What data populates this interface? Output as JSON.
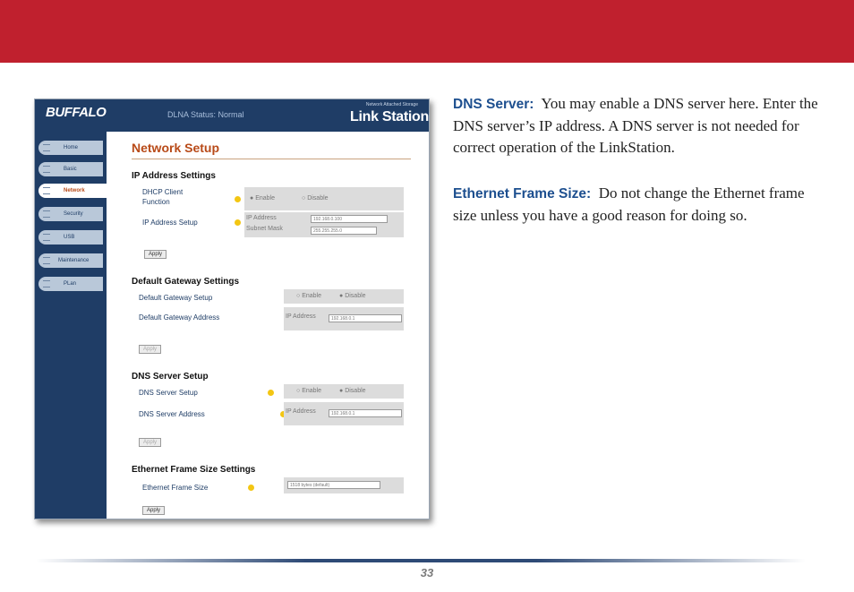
{
  "screenshot": {
    "brand": "BUFFALO",
    "status": "DLNA Status: Normal",
    "product_tagline": "Network Attached Storage",
    "product": "Link Station",
    "nav": [
      "Home",
      "Basic",
      "Network",
      "Security",
      "USB",
      "Maintenance",
      "PLan"
    ],
    "page_title": "Network Setup",
    "ip": {
      "heading": "IP Address Settings",
      "dhcp_label": "DHCP Client Function",
      "enable": "Enable",
      "disable": "Disable",
      "setup_label": "IP Address Setup",
      "ip_label": "IP Address",
      "mask_label": "Subnet Mask",
      "ip_value": "192.168.0.100",
      "mask_value": "255.255.255.0",
      "apply": "Apply"
    },
    "gateway": {
      "heading": "Default Gateway Settings",
      "setup_label": "Default Gateway Setup",
      "address_label": "Default Gateway Address",
      "enable": "Enable",
      "disable": "Disable",
      "ip_label": "IP Address",
      "ip_value": "192.168.0.1",
      "apply": "Apply"
    },
    "dns": {
      "heading": "DNS Server Setup",
      "setup_label": "DNS Server Setup",
      "address_label": "DNS Server Address",
      "enable": "Enable",
      "disable": "Disable",
      "ip_label": "IP Address",
      "ip_value": "192.168.0.1",
      "apply": "Apply"
    },
    "ethernet": {
      "heading": "Ethernet Frame Size Settings",
      "label": "Ethernet Frame Size",
      "value": "1518 bytes (default)",
      "apply": "Apply"
    }
  },
  "text": {
    "dns_term": "DNS Server:",
    "dns_body": "You may enable a DNS server here.  Enter the DNS server’s IP address. A DNS server is not needed for correct operation of the LinkStation.",
    "eth_term": "Ethernet Frame Size:",
    "eth_body": "Do not change the Ethernet frame size unless you have a good reason for doing so."
  },
  "page_number": "33",
  "colors": {
    "top_bar": "#c0202e",
    "term": "#1d4f8f",
    "nav_panel": "#1f3d66",
    "section_title": "#b84a18"
  }
}
